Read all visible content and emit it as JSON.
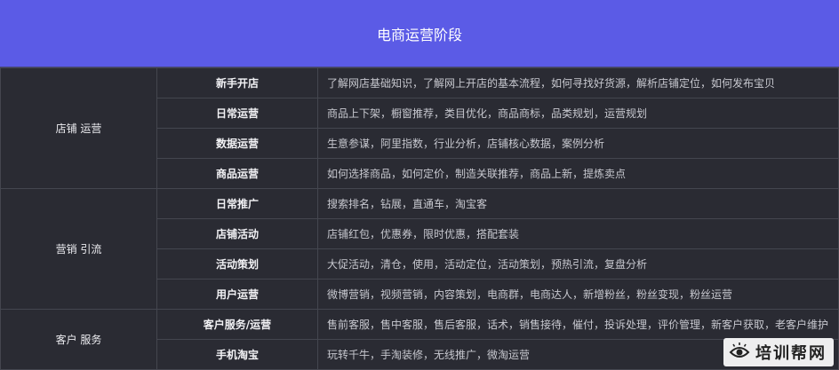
{
  "header": {
    "title": "电商运营阶段"
  },
  "categories": [
    {
      "name": "店铺 运营",
      "rows": [
        {
          "item": "新手开店",
          "desc": "了解网店基础知识，了解网上开店的基本流程，如何寻找好货源，解析店铺定位，如何发布宝贝"
        },
        {
          "item": "日常运营",
          "desc": "商品上下架，橱窗推荐，类目优化，商品商标，品类规划，运营规划"
        },
        {
          "item": "数据运营",
          "desc": "生意参谋，阿里指数，行业分析，店铺核心数据，案例分析"
        },
        {
          "item": "商品运营",
          "desc": "如何选择商品，如何定价，制造关联推荐，商品上新，提炼卖点"
        }
      ]
    },
    {
      "name": "营销 引流",
      "rows": [
        {
          "item": "日常推广",
          "desc": "搜索排名，钻展，直通车，淘宝客"
        },
        {
          "item": "店铺活动",
          "desc": "店铺红包，优惠券，限时优惠，搭配套装"
        },
        {
          "item": "活动策划",
          "desc": "大促活动，清仓，使用，活动定位，活动策划，预热引流，复盘分析"
        },
        {
          "item": "用户运营",
          "desc": "微博营销，视频营销，内容策划，电商群，电商达人，新增粉丝，粉丝变现，粉丝运营"
        }
      ]
    },
    {
      "name": "客户 服务",
      "rows": [
        {
          "item": "客户服务/运营",
          "desc": "售前客服，售中客服，售后客服，话术，销售接待，催付，投诉处理，评价管理，新客户获取，老客户维护"
        },
        {
          "item": "手机淘宝",
          "desc": "玩转千牛，手淘装修，无线推广，微淘运营"
        }
      ]
    }
  ],
  "logo": {
    "text": "培训帮网",
    "icon": "eye-logo-icon"
  }
}
